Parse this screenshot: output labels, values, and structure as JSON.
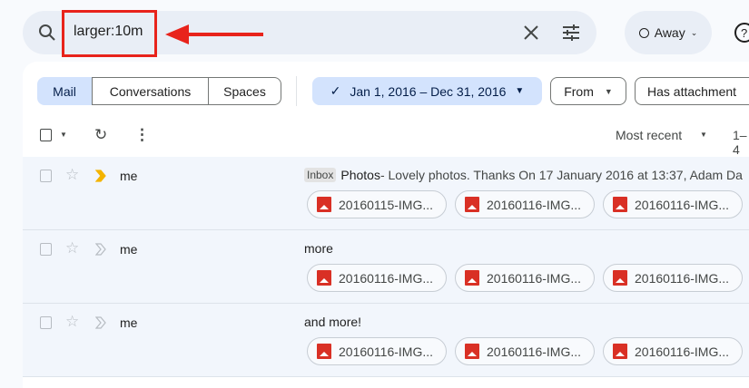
{
  "search": {
    "query": "larger:10m"
  },
  "status": {
    "label": "Away"
  },
  "filters": {
    "tabs": [
      "Mail",
      "Conversations",
      "Spaces"
    ],
    "date_range": "Jan 1, 2016 – Dec 31, 2016",
    "from": "From",
    "has_attachment": "Has attachment"
  },
  "toolbar": {
    "sort": "Most recent",
    "range": "1–4"
  },
  "emails": [
    {
      "sender": "me",
      "label": "Inbox",
      "subject": "Photos",
      "snippet": " - Lovely photos. Thanks On 17 January 2016 at 13:37, Adam Da",
      "important": true,
      "attachments": [
        "20160115-IMG...",
        "20160116-IMG...",
        "20160116-IMG..."
      ]
    },
    {
      "sender": "me",
      "label": "",
      "subject": "more",
      "snippet": "",
      "important": false,
      "attachments": [
        "20160116-IMG...",
        "20160116-IMG...",
        "20160116-IMG..."
      ]
    },
    {
      "sender": "me",
      "label": "",
      "subject": "and more!",
      "snippet": "",
      "important": false,
      "attachments": [
        "20160116-IMG...",
        "20160116-IMG...",
        "20160116-IMG..."
      ]
    }
  ],
  "colors": {
    "accent": "#d3e3fd",
    "annotation": "#e8231b",
    "important": "#f4b400"
  }
}
